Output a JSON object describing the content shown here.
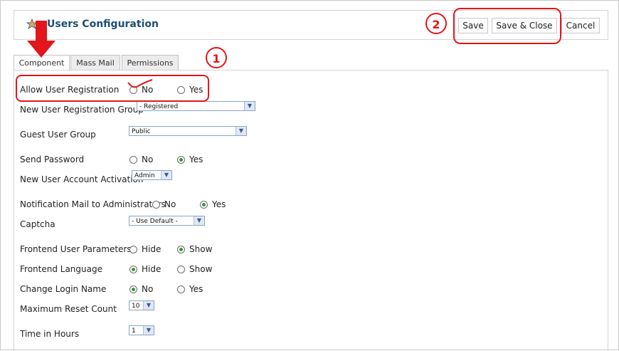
{
  "header": {
    "title": "Users Configuration",
    "buttons": {
      "save": "Save",
      "save_close": "Save & Close",
      "cancel": "Cancel"
    }
  },
  "tabs": [
    {
      "label": "Component",
      "active": true
    },
    {
      "label": "Mass Mail",
      "active": false
    },
    {
      "label": "Permissions",
      "active": false
    }
  ],
  "settings": {
    "allow_registration": {
      "label": "Allow User Registration",
      "opt1": "No",
      "opt2": "Yes",
      "selected": "No"
    },
    "new_user_group": {
      "label": "New User Registration Group",
      "value": "- Registered"
    },
    "guest_group": {
      "label": "Guest User Group",
      "value": "Public"
    },
    "send_password": {
      "label": "Send Password",
      "opt1": "No",
      "opt2": "Yes",
      "selected": "Yes"
    },
    "account_activation": {
      "label": "New User Account Activation",
      "value": "Admin"
    },
    "notify_admins": {
      "label": "Notification Mail to Administrators",
      "opt1": "No",
      "opt2": "Yes",
      "selected": "Yes"
    },
    "captcha": {
      "label": "Captcha",
      "value": "- Use Default -"
    },
    "frontend_params": {
      "label": "Frontend User Parameters",
      "opt1": "Hide",
      "opt2": "Show",
      "selected": "Show"
    },
    "frontend_language": {
      "label": "Frontend Language",
      "opt1": "Hide",
      "opt2": "Show",
      "selected": "Hide"
    },
    "change_login": {
      "label": "Change Login Name",
      "opt1": "No",
      "opt2": "Yes",
      "selected": "No"
    },
    "max_reset": {
      "label": "Maximum Reset Count",
      "value": "10"
    },
    "time_hours": {
      "label": "Time in Hours",
      "value": "1"
    }
  },
  "annotations": {
    "marker1": "1",
    "marker2": "2"
  },
  "colors": {
    "annotation": "#e3161b",
    "title": "#1a4f74",
    "radio_checked": "#2f9a35"
  }
}
